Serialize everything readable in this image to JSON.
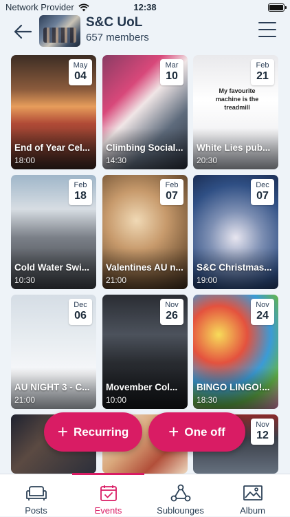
{
  "status_bar": {
    "carrier": "Network Provider",
    "time": "12:38"
  },
  "header": {
    "group_name": "S&C UoL",
    "members": "657 members"
  },
  "events": [
    {
      "month": "May",
      "day": "04",
      "title": "End of Year Cel...",
      "time": "18:00"
    },
    {
      "month": "Mar",
      "day": "10",
      "title": "Climbing Social...",
      "time": "14:30"
    },
    {
      "month": "Feb",
      "day": "21",
      "title": "White Lies pub...",
      "time": "20:30"
    },
    {
      "month": "Feb",
      "day": "18",
      "title": "Cold Water Swi...",
      "time": "10:30"
    },
    {
      "month": "Feb",
      "day": "07",
      "title": "Valentines AU n...",
      "time": "21:00"
    },
    {
      "month": "Dec",
      "day": "07",
      "title": "S&C Christmas...",
      "time": "19:00"
    },
    {
      "month": "Dec",
      "day": "06",
      "title": "AU NIGHT 3 - C...",
      "time": "21:00"
    },
    {
      "month": "Nov",
      "day": "26",
      "title": "Movember Col...",
      "time": "10:00"
    },
    {
      "month": "Nov",
      "day": "24",
      "title": "BINGO LINGO!...",
      "time": "18:30"
    },
    {
      "month": "",
      "day": "",
      "title": "",
      "time": ""
    },
    {
      "month": "",
      "day": "",
      "title": "",
      "time": ""
    },
    {
      "month": "Nov",
      "day": "12",
      "title": "",
      "time": ""
    }
  ],
  "tshirt_text": "My favourite machine is the treadmill",
  "fabs": {
    "recurring": "Recurring",
    "one_off": "One off"
  },
  "tabs": [
    {
      "label": "Posts",
      "icon": "sofa-icon"
    },
    {
      "label": "Events",
      "icon": "calendar-check-icon"
    },
    {
      "label": "Sublounges",
      "icon": "network-icon"
    },
    {
      "label": "Album",
      "icon": "image-icon"
    }
  ],
  "colors": {
    "accent": "#d91c64",
    "text": "#23364d",
    "background": "#eef3f8"
  }
}
